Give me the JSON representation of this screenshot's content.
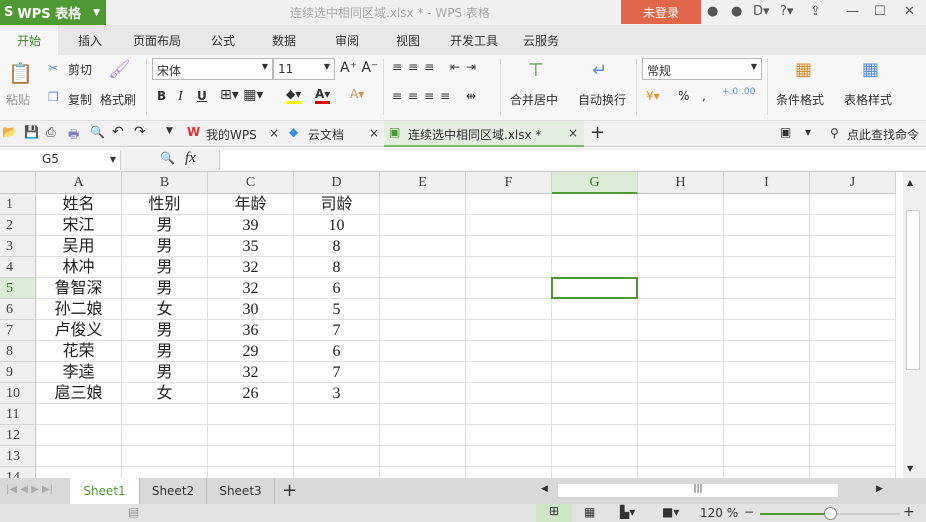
{
  "app": {
    "name": "WPS 表格",
    "doc_title": "连续选中相同区域.xlsx * - WPS 表格",
    "login": "未登录"
  },
  "menu_tabs": [
    "开始",
    "插入",
    "页面布局",
    "公式",
    "数据",
    "审阅",
    "视图",
    "开发工具",
    "云服务"
  ],
  "ribbon": {
    "paste": "粘贴",
    "cut": "剪切",
    "copy": "复制",
    "format_painter": "格式刷",
    "font": "宋体",
    "size": "11",
    "merge": "合并居中",
    "wrap": "自动换行",
    "number_format": "常规",
    "cond_format": "条件格式",
    "table_style": "表格样式"
  },
  "doc_tabs": [
    "我的WPS",
    "云文档",
    "连续选中相同区域.xlsx *"
  ],
  "search_cmd": "点此查找命令",
  "formula": {
    "name_box": "G5",
    "fx": "fx",
    "value": ""
  },
  "columns": [
    "A",
    "B",
    "C",
    "D",
    "E",
    "F",
    "G",
    "H",
    "I",
    "J"
  ],
  "rows": [
    [
      "姓名",
      "性别",
      "年龄",
      "司龄"
    ],
    [
      "宋江",
      "男",
      "39",
      "10"
    ],
    [
      "吴用",
      "男",
      "35",
      "8"
    ],
    [
      "林冲",
      "男",
      "32",
      "8"
    ],
    [
      "鲁智深",
      "男",
      "32",
      "6"
    ],
    [
      "孙二娘",
      "女",
      "30",
      "5"
    ],
    [
      "卢俊义",
      "男",
      "36",
      "7"
    ],
    [
      "花荣",
      "男",
      "29",
      "6"
    ],
    [
      "李逵",
      "男",
      "32",
      "7"
    ],
    [
      "扈三娘",
      "女",
      "26",
      "3"
    ],
    [],
    [],
    [],
    []
  ],
  "sheets": [
    "Sheet1",
    "Sheet2",
    "Sheet3"
  ],
  "zoom": "120 %",
  "colors": {
    "accent": "#4f9a34",
    "login": "#e0674a"
  }
}
